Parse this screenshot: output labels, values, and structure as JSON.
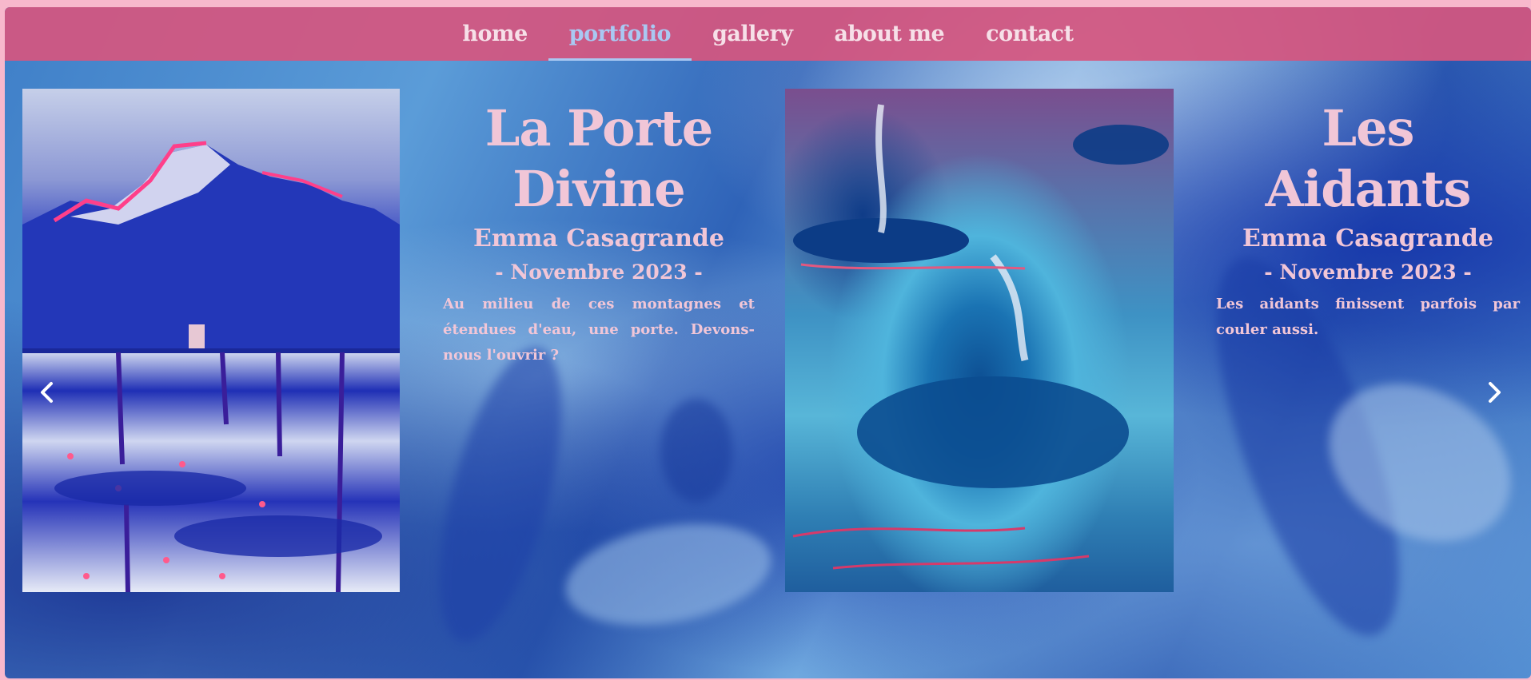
{
  "nav": {
    "items": [
      {
        "label": "home"
      },
      {
        "label": "portfolio"
      },
      {
        "label": "gallery"
      },
      {
        "label": "about me"
      },
      {
        "label": "contact"
      }
    ],
    "active_index": 1
  },
  "slides": [
    {
      "title": "La Porte Divine",
      "artist": "Emma Casagrande",
      "date": "- Novembre 2023 -",
      "description": "Au milieu de ces montagnes et étendues d'eau, une porte. Devons-nous l'ouvrir ?"
    },
    {
      "title": "Les Aidants",
      "artist": "Emma Casagrande",
      "date": "- Novembre 2023 -",
      "description": "Les aidants finissent parfois par couler aussi."
    }
  ],
  "icons": {
    "prev": "chevron-left-icon",
    "next": "chevron-right-icon"
  },
  "colors": {
    "navbar": "#d6567f",
    "nav_text": "#f6e0e8",
    "nav_active": "#a9c8f2",
    "caption_text": "#f1c6d7",
    "page_border": "#f7b8cc"
  }
}
